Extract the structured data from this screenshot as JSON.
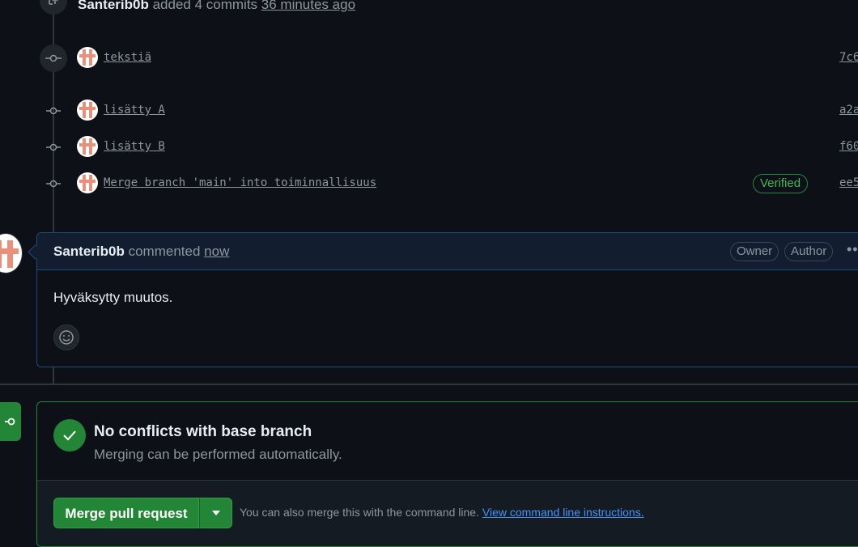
{
  "timeline": {
    "push_author": "Santerib0b",
    "push_action": "added 4 commits",
    "push_time": "36 minutes ago",
    "push_icon": "push-icon"
  },
  "commits": [
    {
      "message": "tekstiä",
      "sha": "7c6",
      "verified": ""
    },
    {
      "message": "lisätty A",
      "sha": "a2a",
      "verified": ""
    },
    {
      "message": "lisätty B",
      "sha": "f60",
      "verified": ""
    },
    {
      "message": "Merge branch 'main' into toiminnallisuus",
      "sha": "ee5",
      "verified": "Verified"
    }
  ],
  "comment": {
    "author": "Santerib0b",
    "action": "commented",
    "time": "now",
    "labels": [
      "Owner",
      "Author"
    ],
    "body": "Hyväksytty muutos.",
    "more_icon": "kebab-icon",
    "emoji_icon": "smiley-icon"
  },
  "merge": {
    "title": "No conflicts with base branch",
    "subtitle": "Merging can be performed automatically.",
    "button_label": "Merge pull request",
    "hint_text": "You can also merge this with the command line.",
    "hint_link": "View command line instructions.",
    "status_icon": "check-icon",
    "side_icon": "git-merge-icon"
  },
  "colors": {
    "background": "#0d1117",
    "accent_green": "#238636",
    "verified_green": "#3fb950",
    "link_blue": "#4493f8",
    "comment_border": "#1f4a7a",
    "muted_text": "#8d96a0"
  }
}
